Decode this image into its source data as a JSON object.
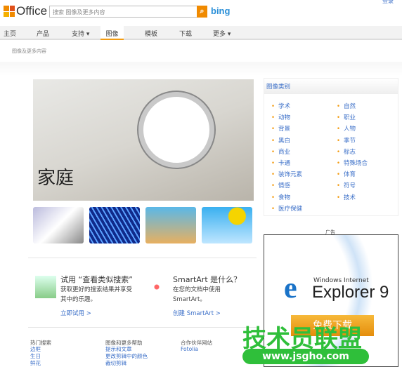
{
  "header": {
    "logo": "Office",
    "search_placeholder": "搜索 图像及更多内容",
    "search_provider": "bing",
    "login": "登录"
  },
  "nav": [
    {
      "label": "主页"
    },
    {
      "label": "产品"
    },
    {
      "label": "支持 ▾"
    },
    {
      "label": "图像",
      "active": true
    },
    {
      "label": "模板"
    },
    {
      "label": "下载"
    },
    {
      "label": "更多 ▾"
    }
  ],
  "breadcrumb": "图像及更多内容",
  "hero": {
    "title": "家庭"
  },
  "promos": [
    {
      "title": "试用 “查看类似搜索”",
      "text1": "获取更好的搜索结果并享受",
      "text2": "其中的乐趣。",
      "link": "立即试用 >"
    },
    {
      "title": "SmartArt 是什么？",
      "text1": "在您的文档中使用",
      "text2": "SmartArt。",
      "link": "创建 SmartArt >"
    }
  ],
  "footer": [
    {
      "heading": "热门搜索",
      "links": [
        "边框",
        "生日",
        "鲜花"
      ]
    },
    {
      "heading": "图像和更多帮助",
      "links": [
        "提示和文章",
        "更改剪辑中的颜色",
        "裁切剪辑"
      ]
    },
    {
      "heading": "合作伙伴网站",
      "links": [
        "Fotolia"
      ]
    }
  ],
  "categories": {
    "title": "图像类别",
    "left": [
      "学术",
      "动物",
      "背景",
      "黑白",
      "商业",
      "卡通",
      "装饰元素",
      "情感",
      "食物",
      "医疗保健"
    ],
    "right": [
      "自然",
      "职业",
      "人物",
      "季节",
      "标志",
      "特殊场合",
      "体育",
      "符号",
      "技术"
    ]
  },
  "ad": {
    "label": "广告",
    "brand_line": "Windows Internet",
    "product": "Explorer 9",
    "button": "免费下载"
  },
  "watermark": {
    "text": "技术员联盟",
    "url": "www.jsgho.com"
  },
  "colors": {
    "accent": "#f39c12",
    "link": "#3b6fc8"
  }
}
